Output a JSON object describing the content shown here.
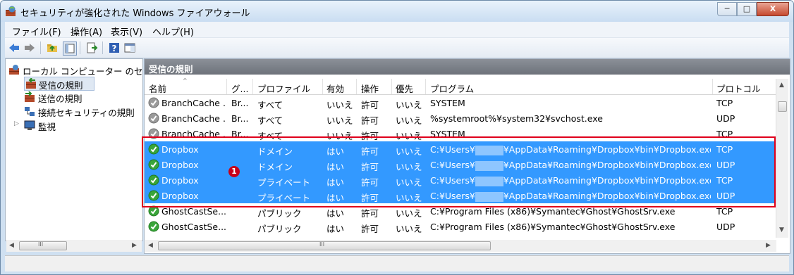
{
  "window": {
    "title": "セキュリティが強化された Windows ファイアウォール",
    "min_label": "─",
    "max_label": "□",
    "close_label": "X"
  },
  "menu": [
    "ファイル(F)",
    "操作(A)",
    "表示(V)",
    "ヘルプ(H)"
  ],
  "tree": [
    {
      "label": "ローカル コンピューター のセ",
      "icon": "firewall-icon"
    },
    {
      "label": "受信の規則",
      "icon": "inbound-rules-icon"
    },
    {
      "label": "送信の規則",
      "icon": "outbound-rules-icon"
    },
    {
      "label": "接続セキュリティの規則",
      "icon": "connection-security-icon"
    },
    {
      "label": "監視",
      "icon": "monitor-icon"
    }
  ],
  "pane_title": "受信の規則",
  "columns": [
    "名前",
    "グ...",
    "プロファイル",
    "有効",
    "操作",
    "優先",
    "プログラム",
    "プロトコル"
  ],
  "rows": [
    {
      "name": "BranchCache ...",
      "group": "Br...",
      "profile": "すべて",
      "enabled": "いいえ",
      "action": "許可",
      "override": "いいえ",
      "program": "SYSTEM",
      "protocol": "TCP",
      "icon": "disabled-rule-icon"
    },
    {
      "name": "BranchCache ...",
      "group": "Br...",
      "profile": "すべて",
      "enabled": "いいえ",
      "action": "許可",
      "override": "いいえ",
      "program": "%systemroot%¥system32¥svchost.exe",
      "protocol": "UDP",
      "icon": "disabled-rule-icon"
    },
    {
      "name": "BranchCache ...",
      "group": "Br...",
      "profile": "すべて",
      "enabled": "いいえ",
      "action": "許可",
      "override": "いいえ",
      "program": "SYSTEM",
      "protocol": "TCP",
      "icon": "disabled-rule-icon"
    },
    {
      "name": "Dropbox",
      "group": "",
      "profile": "ドメイン",
      "enabled": "はい",
      "action": "許可",
      "override": "いいえ",
      "program_pre": "C:¥Users¥",
      "program_post": "¥AppData¥Roaming¥Dropbox¥bin¥Dropbox.exe",
      "protocol": "TCP",
      "icon": "enabled-rule-icon"
    },
    {
      "name": "Dropbox",
      "group": "",
      "profile": "ドメイン",
      "enabled": "はい",
      "action": "許可",
      "override": "いいえ",
      "program_pre": "C:¥Users¥",
      "program_post": "¥AppData¥Roaming¥Dropbox¥bin¥Dropbox.exe",
      "protocol": "UDP",
      "icon": "enabled-rule-icon"
    },
    {
      "name": "Dropbox",
      "group": "",
      "profile": "プライベート",
      "enabled": "はい",
      "action": "許可",
      "override": "いいえ",
      "program_pre": "C:¥Users¥",
      "program_post": "¥AppData¥Roaming¥Dropbox¥bin¥Dropbox.exe",
      "protocol": "TCP",
      "icon": "enabled-rule-icon"
    },
    {
      "name": "Dropbox",
      "group": "",
      "profile": "プライベート",
      "enabled": "はい",
      "action": "許可",
      "override": "いいえ",
      "program_pre": "C:¥Users¥",
      "program_post": "¥AppData¥Roaming¥Dropbox¥bin¥Dropbox.exe",
      "protocol": "UDP",
      "icon": "enabled-rule-icon"
    },
    {
      "name": "GhostCastSe...",
      "group": "",
      "profile": "パブリック",
      "enabled": "はい",
      "action": "許可",
      "override": "いいえ",
      "program": "C:¥Program Files (x86)¥Symantec¥Ghost¥GhostSrv.exe",
      "protocol": "TCP",
      "icon": "enabled-rule-icon"
    },
    {
      "name": "GhostCastSe...",
      "group": "",
      "profile": "パブリック",
      "enabled": "はい",
      "action": "許可",
      "override": "いいえ",
      "program": "C:¥Program Files (x86)¥Symantec¥Ghost¥GhostSrv.exe",
      "protocol": "UDP",
      "icon": "enabled-rule-icon"
    }
  ],
  "annotation_badge": "1",
  "scroll_grip": "III",
  "colors": {
    "selection": "#3399ff",
    "highlight_box": "#e0001b",
    "badge": "#c8001a"
  }
}
